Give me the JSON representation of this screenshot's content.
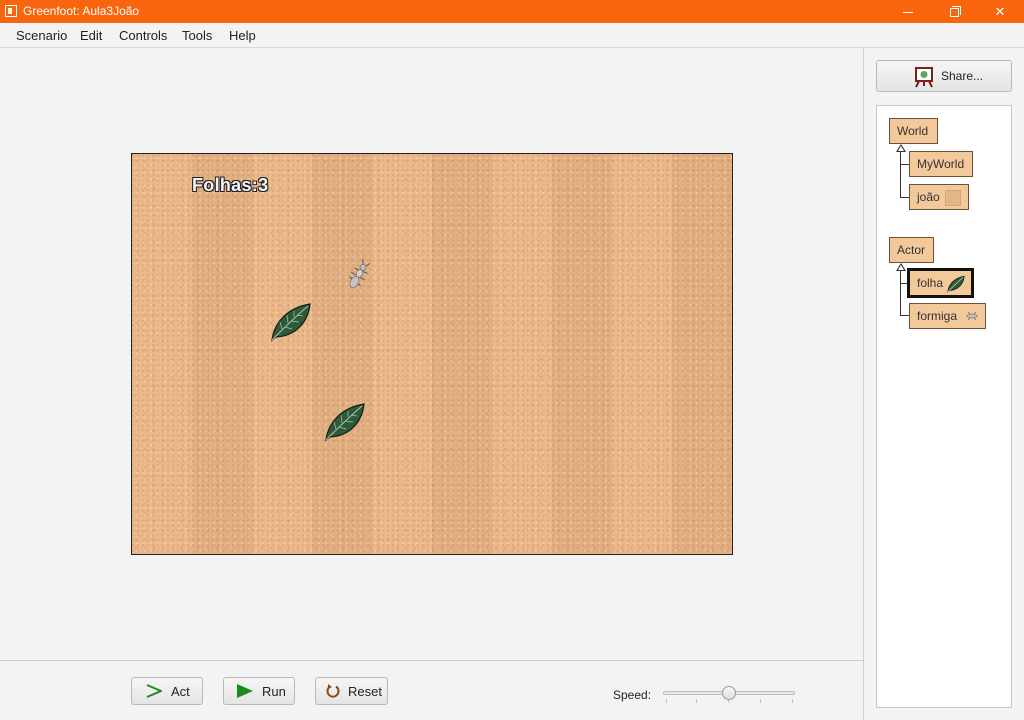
{
  "window": {
    "title": "Greenfoot: Aula3João",
    "icons": {
      "app": "greenfoot-app-icon",
      "minimize": "minimize-icon",
      "maximize": "restore-icon",
      "close": "close-icon"
    }
  },
  "menu": {
    "items": [
      {
        "label": "Scenario"
      },
      {
        "label": "Edit"
      },
      {
        "label": "Controls"
      },
      {
        "label": "Tools"
      },
      {
        "label": "Help"
      }
    ]
  },
  "world": {
    "counter_text": "Folhas:3",
    "background_color": "#e9b585",
    "actors": [
      {
        "type": "ant",
        "icon": "ant-icon"
      },
      {
        "type": "leaf",
        "icon": "leaf-icon"
      },
      {
        "type": "leaf",
        "icon": "leaf-icon"
      }
    ]
  },
  "controls": {
    "act_label": "Act",
    "run_label": "Run",
    "reset_label": "Reset",
    "speed_label": "Speed:",
    "speed_value": 0.5,
    "icons": {
      "act": "step-arrow-icon",
      "run": "play-icon",
      "reset": "reset-icon"
    }
  },
  "share": {
    "label": "Share...",
    "icon": "easel-share-icon"
  },
  "class_tree": {
    "world_root": "World",
    "world_subclasses": [
      {
        "label": "MyWorld"
      },
      {
        "label": "joão",
        "icon": "world-texture-icon"
      }
    ],
    "actor_root": "Actor",
    "actor_subclasses": [
      {
        "label": "folha",
        "icon": "leaf-icon",
        "selected": true
      },
      {
        "label": "formiga",
        "icon": "ant-icon"
      }
    ]
  },
  "colors": {
    "titlebar": "#f7650f",
    "class_box": "#f3c89a",
    "world_bg": "#e9b585",
    "leaf": "#2f5a3a",
    "run_green": "#1f8a1f",
    "reset_brown": "#8a4b1a"
  }
}
